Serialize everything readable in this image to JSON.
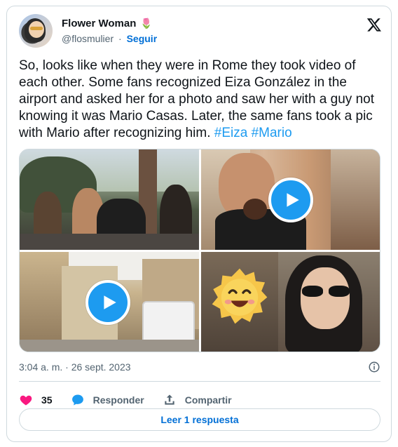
{
  "author": {
    "name": "Flower Woman",
    "name_emoji": "🌷",
    "handle": "@flosmulier",
    "separator": "·",
    "follow_label": "Seguir"
  },
  "tweet": {
    "text_main": "So, looks like when they were in Rome they took video of each other. Some fans recognized Eiza González in the airport and asked her for a photo and saw her with a guy not knowing it was Mario Casas. Later, the same fans took a pic with Mario after recognizing him. ",
    "hashtags": [
      "#Eiza",
      "#Mario"
    ]
  },
  "media": [
    {
      "kind": "photo",
      "icon": null
    },
    {
      "kind": "video",
      "icon": "play-icon"
    },
    {
      "kind": "video",
      "icon": "play-icon"
    },
    {
      "kind": "photo",
      "icon": "smiling-emoji-icon"
    }
  ],
  "meta": {
    "timestamp": "3:04 a. m. · 26 sept. 2023",
    "info_icon": "info-icon"
  },
  "actions": {
    "like_count": "35",
    "reply_label": "Responder",
    "share_label": "Compartir"
  },
  "read_reply_label": "Leer 1 respuesta",
  "colors": {
    "accent": "#1d9bf0",
    "link": "#006fd6",
    "like": "#f91880",
    "border": "#cfd9de",
    "muted": "#536471"
  }
}
